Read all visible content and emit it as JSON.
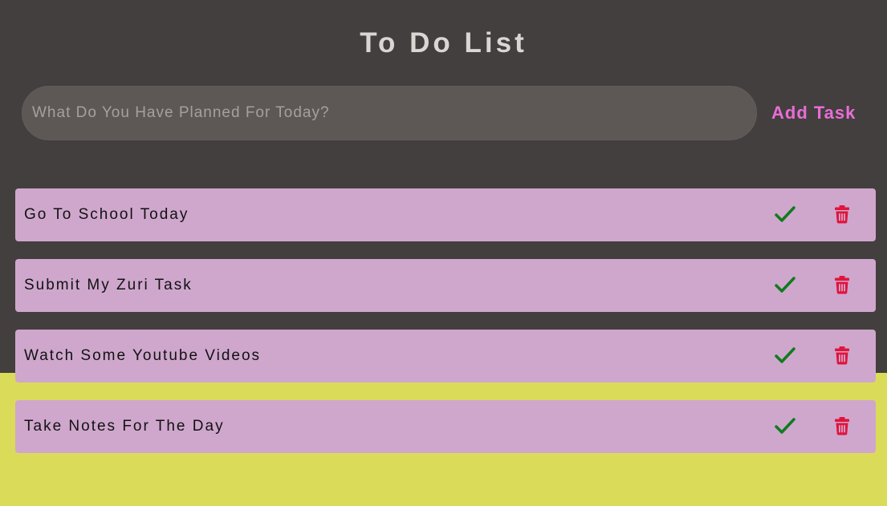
{
  "header": {
    "title": "To Do List"
  },
  "task_entry": {
    "placeholder": "What Do You Have Planned For Today?",
    "value": "",
    "add_label": "Add Task"
  },
  "tasks": [
    {
      "label": "Go To School Today"
    },
    {
      "label": "Submit My Zuri Task"
    },
    {
      "label": "Watch Some Youtube Videos"
    },
    {
      "label": "Take Notes For The Day"
    }
  ],
  "icons": {
    "complete": "check-icon",
    "delete": "trash-icon"
  },
  "colors": {
    "panel_background": "#433f3e",
    "page_background": "#dbdb5a",
    "task_background": "#cfa7cd",
    "accent": "#e86dd7",
    "complete_icon": "#0f7b1c",
    "delete_icon": "#e0143c"
  }
}
